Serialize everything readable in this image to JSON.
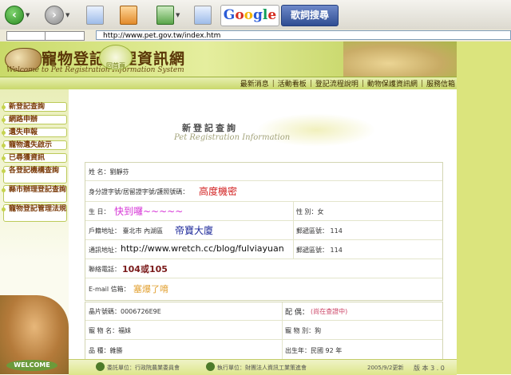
{
  "browser": {
    "google_logo": "Google",
    "search_button": "歌詞搜尋",
    "url": "http://www.pet.gov.tw/index.htm",
    "mini_buttons": [
      "",
      ""
    ]
  },
  "site": {
    "title": "寵物登記管理資訊網",
    "subtitle": "Welcome to Pet Registration Information System",
    "home_badge": "回首頁",
    "nav": [
      "最新消息",
      "活動看板",
      "登記流程說明",
      "動物保護資訊網",
      "服務信箱"
    ]
  },
  "sidebar": {
    "items": [
      "新登記查詢",
      "網路申辦",
      "遺失申報",
      "寵物遺失啟示",
      "已尋獲資訊",
      "各登記機構查詢",
      "縣市辦理登記查詢",
      "寵物登記管理法規"
    ],
    "welcome": "WELCOME"
  },
  "content": {
    "title": "新登記查詢",
    "subtitle": "Pet Registration Information"
  },
  "card1": {
    "name_label": "姓 名：劉靜芬",
    "id_label": "身分證字號/居留證字號/護照號碼：",
    "id_value": "高度機密",
    "birth_label": "生 日：",
    "birth_value": "快到囉~~~~~",
    "gender_label": "性 別：女",
    "addr_label": "戶籍地址： 臺北市 內湖區",
    "addr_value": "帝寶大廈",
    "zip1_label": "郵遞區號： 114",
    "mail_addr_label": "通訊地址：",
    "mail_addr_value": "http://www.wretch.cc/blog/fulviayuan",
    "zip2_label": "郵遞區號： 114",
    "phone_label": "聯絡電話：",
    "phone_value": "104或105",
    "email_label": "E-mail 信箱：",
    "email_value": "塞爆了唷"
  },
  "card2": {
    "chip_label": "晶片號碼：0006726E9E",
    "spouse_label": "配 偶：",
    "spouse_value": "(尚在查證中)",
    "pet_name_label": "寵 物 名：福妹",
    "pet_type_label": "寵 物 別：狗",
    "breed_label": "品 種：雜勝",
    "birth_year_label": "出生年：民國 92 年"
  },
  "footer": {
    "supervisor": "委託單位：行政院農業委員會",
    "executor": "執行單位：財團法人資訊工業策進會",
    "updated": "2005/9/2更新",
    "version": "版 本 3 . 0"
  }
}
